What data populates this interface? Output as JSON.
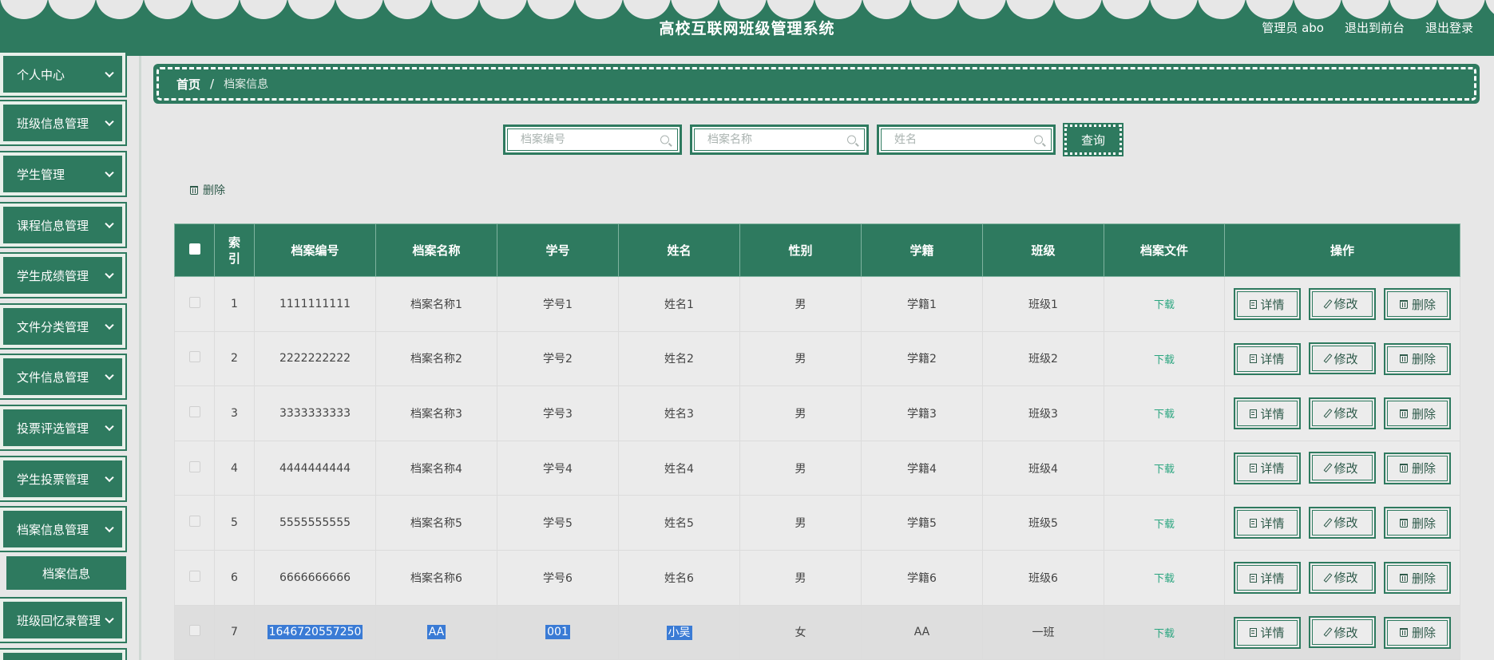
{
  "header": {
    "title": "高校互联网班级管理系统",
    "user": "管理员 abo",
    "to_front": "退出到前台",
    "logout": "退出登录"
  },
  "sidebar": {
    "items": [
      {
        "label": "个人中心"
      },
      {
        "label": "班级信息管理"
      },
      {
        "label": "学生管理"
      },
      {
        "label": "课程信息管理"
      },
      {
        "label": "学生成绩管理"
      },
      {
        "label": "文件分类管理"
      },
      {
        "label": "文件信息管理"
      },
      {
        "label": "投票评选管理"
      },
      {
        "label": "学生投票管理"
      },
      {
        "label": "档案信息管理"
      },
      {
        "label": "班级回忆录管理"
      }
    ],
    "active_sub": "档案信息"
  },
  "breadcrumb": {
    "home": "首页",
    "sep": "/",
    "current": "档案信息"
  },
  "search": {
    "p1": "档案编号",
    "p2": "档案名称",
    "p3": "姓名",
    "query": "查询"
  },
  "toolbar": {
    "delete": "删除"
  },
  "table": {
    "headers": [
      "",
      "索引",
      "档案编号",
      "档案名称",
      "学号",
      "姓名",
      "性别",
      "学籍",
      "班级",
      "档案文件",
      "操作"
    ],
    "download": "下载",
    "actions": {
      "detail": "详情",
      "edit": "修改",
      "delete": "删除"
    },
    "rows": [
      {
        "idx": "1",
        "no": "1111111111",
        "name": "档案名称1",
        "sid": "学号1",
        "xm": "姓名1",
        "sex": "男",
        "xj": "学籍1",
        "bj": "班级1"
      },
      {
        "idx": "2",
        "no": "2222222222",
        "name": "档案名称2",
        "sid": "学号2",
        "xm": "姓名2",
        "sex": "男",
        "xj": "学籍2",
        "bj": "班级2"
      },
      {
        "idx": "3",
        "no": "3333333333",
        "name": "档案名称3",
        "sid": "学号3",
        "xm": "姓名3",
        "sex": "男",
        "xj": "学籍3",
        "bj": "班级3"
      },
      {
        "idx": "4",
        "no": "4444444444",
        "name": "档案名称4",
        "sid": "学号4",
        "xm": "姓名4",
        "sex": "男",
        "xj": "学籍4",
        "bj": "班级4"
      },
      {
        "idx": "5",
        "no": "5555555555",
        "name": "档案名称5",
        "sid": "学号5",
        "xm": "姓名5",
        "sex": "男",
        "xj": "学籍5",
        "bj": "班级5"
      },
      {
        "idx": "6",
        "no": "6666666666",
        "name": "档案名称6",
        "sid": "学号6",
        "xm": "姓名6",
        "sex": "男",
        "xj": "学籍6",
        "bj": "班级6"
      },
      {
        "idx": "7",
        "no": "1646720557250",
        "name": "AA",
        "sid": "001",
        "xm": "小吴",
        "sex": "女",
        "xj": "AA",
        "bj": "一班"
      }
    ]
  }
}
